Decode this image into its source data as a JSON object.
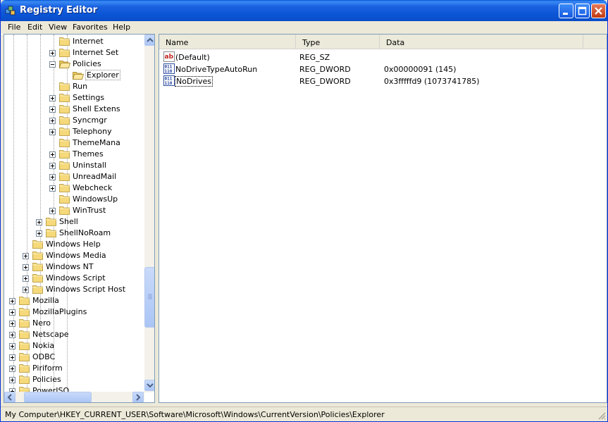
{
  "window": {
    "title": "Registry Editor"
  },
  "menu": [
    "File",
    "Edit",
    "View",
    "Favorites",
    "Help"
  ],
  "tree": [
    {
      "label": "Internet",
      "depth": 5,
      "expander": "none",
      "icon": "folder-closed"
    },
    {
      "label": "Internet Set",
      "depth": 5,
      "expander": "plus",
      "icon": "folder-closed"
    },
    {
      "label": "Policies",
      "depth": 5,
      "expander": "minus",
      "icon": "folder-open"
    },
    {
      "label": "Explorer",
      "depth": 6,
      "expander": "none",
      "icon": "folder-open",
      "selected": true
    },
    {
      "label": "Run",
      "depth": 5,
      "expander": "none",
      "icon": "folder-closed"
    },
    {
      "label": "Settings",
      "depth": 5,
      "expander": "plus",
      "icon": "folder-closed"
    },
    {
      "label": "Shell Extens",
      "depth": 5,
      "expander": "plus",
      "icon": "folder-closed"
    },
    {
      "label": "Syncmgr",
      "depth": 5,
      "expander": "plus",
      "icon": "folder-closed"
    },
    {
      "label": "Telephony",
      "depth": 5,
      "expander": "plus",
      "icon": "folder-closed"
    },
    {
      "label": "ThemeMana",
      "depth": 5,
      "expander": "none",
      "icon": "folder-closed"
    },
    {
      "label": "Themes",
      "depth": 5,
      "expander": "plus",
      "icon": "folder-closed"
    },
    {
      "label": "Uninstall",
      "depth": 5,
      "expander": "plus",
      "icon": "folder-closed"
    },
    {
      "label": "UnreadMail",
      "depth": 5,
      "expander": "plus",
      "icon": "folder-closed"
    },
    {
      "label": "Webcheck",
      "depth": 5,
      "expander": "plus",
      "icon": "folder-closed"
    },
    {
      "label": "WindowsUp",
      "depth": 5,
      "expander": "none",
      "icon": "folder-closed"
    },
    {
      "label": "WinTrust",
      "depth": 5,
      "expander": "plus",
      "icon": "folder-closed"
    },
    {
      "label": "Shell",
      "depth": 4,
      "expander": "plus",
      "icon": "folder-closed"
    },
    {
      "label": "ShellNoRoam",
      "depth": 4,
      "expander": "plus",
      "icon": "folder-closed"
    },
    {
      "label": "Windows Help",
      "depth": 3,
      "expander": "none",
      "icon": "folder-closed"
    },
    {
      "label": "Windows Media",
      "depth": 3,
      "expander": "plus",
      "icon": "folder-closed"
    },
    {
      "label": "Windows NT",
      "depth": 3,
      "expander": "plus",
      "icon": "folder-closed"
    },
    {
      "label": "Windows Script",
      "depth": 3,
      "expander": "plus",
      "icon": "folder-closed"
    },
    {
      "label": "Windows Script Host",
      "depth": 3,
      "expander": "plus",
      "icon": "folder-closed"
    },
    {
      "label": "Mozilla",
      "depth": 2,
      "expander": "plus",
      "icon": "folder-closed"
    },
    {
      "label": "MozillaPlugins",
      "depth": 2,
      "expander": "plus",
      "icon": "folder-closed"
    },
    {
      "label": "Nero",
      "depth": 2,
      "expander": "plus",
      "icon": "folder-closed"
    },
    {
      "label": "Netscape",
      "depth": 2,
      "expander": "plus",
      "icon": "folder-closed"
    },
    {
      "label": "Nokia",
      "depth": 2,
      "expander": "plus",
      "icon": "folder-closed"
    },
    {
      "label": "ODBC",
      "depth": 2,
      "expander": "plus",
      "icon": "folder-closed"
    },
    {
      "label": "Piriform",
      "depth": 2,
      "expander": "plus",
      "icon": "folder-closed"
    },
    {
      "label": "Policies",
      "depth": 2,
      "expander": "plus",
      "icon": "folder-closed"
    },
    {
      "label": "PowerISO",
      "depth": 2,
      "expander": "plus",
      "icon": "folder-closed"
    }
  ],
  "list": {
    "columns": [
      "Name",
      "Type",
      "Data"
    ],
    "rows": [
      {
        "name": "(Default)",
        "type": "REG_SZ",
        "data": "",
        "icon": "string-value-icon"
      },
      {
        "name": "NoDriveTypeAutoRun",
        "type": "REG_DWORD",
        "data": "0x00000091 (145)",
        "icon": "binary-value-icon"
      },
      {
        "name": "NoDrives",
        "type": "REG_DWORD",
        "data": "0x3fffffd9 (1073741785)",
        "icon": "binary-value-icon",
        "focused": true
      }
    ]
  },
  "status": "My Computer\\HKEY_CURRENT_USER\\Software\\Microsoft\\Windows\\CurrentVersion\\Policies\\Explorer",
  "colors": {
    "titlebar": "#0a55d5",
    "folder": "#f5d97a",
    "selection": "#316ac5"
  }
}
